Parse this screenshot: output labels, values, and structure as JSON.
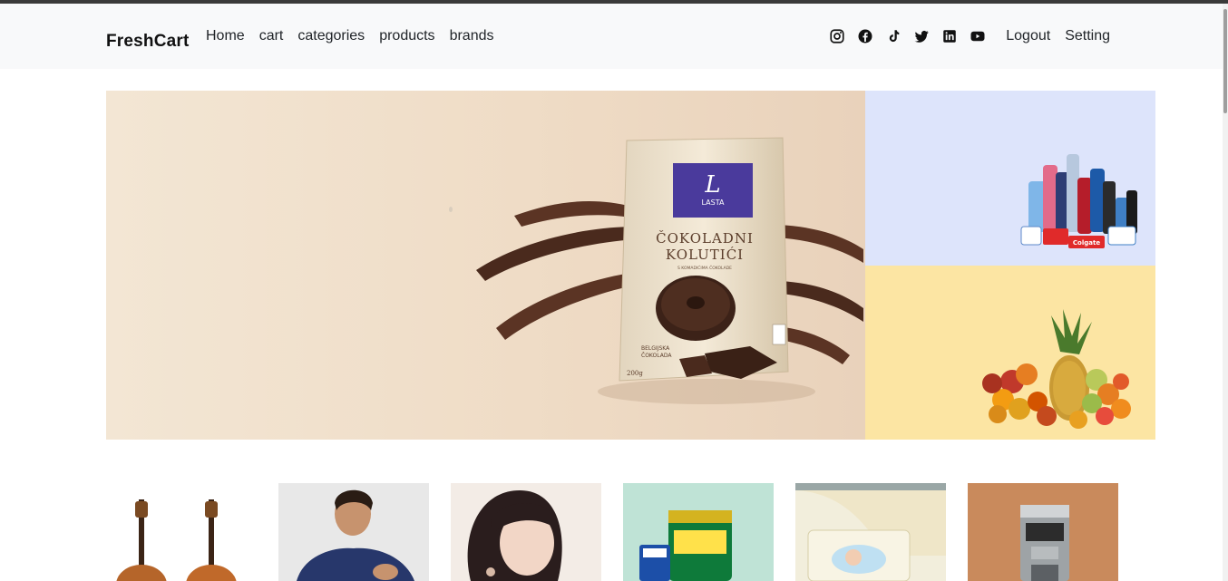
{
  "navbar": {
    "brand": "FreshCart",
    "links": [
      "Home",
      "cart",
      "categories",
      "products",
      "brands"
    ],
    "social_icons": [
      "instagram-icon",
      "facebook-icon",
      "tiktok-icon",
      "twitter-icon",
      "linkedin-icon",
      "youtube-icon"
    ],
    "right_links": [
      "Logout",
      "Setting"
    ]
  },
  "hero": {
    "main_slide": {
      "brand_logo": "L",
      "brand_name": "LASTA",
      "product_title_line1": "ČOKOLADNI",
      "product_title_line2": "KOLUTIĆI",
      "subtitle_small": "S KOMADIĆIMA ČOKOLADE",
      "flavor_line1": "BELGIJSKA",
      "flavor_line2": "ČOKOLADA",
      "weight": "200g"
    },
    "side_top_label": "Colgate",
    "colors": {
      "main_bg": "#efdcc6",
      "side_top_bg": "#dde4fb",
      "side_bottom_bg": "#fce5a3"
    }
  },
  "products": [
    {
      "name": "guitars",
      "bg": "#ffffff"
    },
    {
      "name": "hoodie",
      "bg": "#ececec"
    },
    {
      "name": "portrait",
      "bg": "#f3ece6"
    },
    {
      "name": "milk-powder",
      "bg": "#bfe3d6"
    },
    {
      "name": "diapers",
      "bg": "#f2eedc"
    },
    {
      "name": "coffee-machine",
      "bg": "#c98a5c"
    }
  ]
}
